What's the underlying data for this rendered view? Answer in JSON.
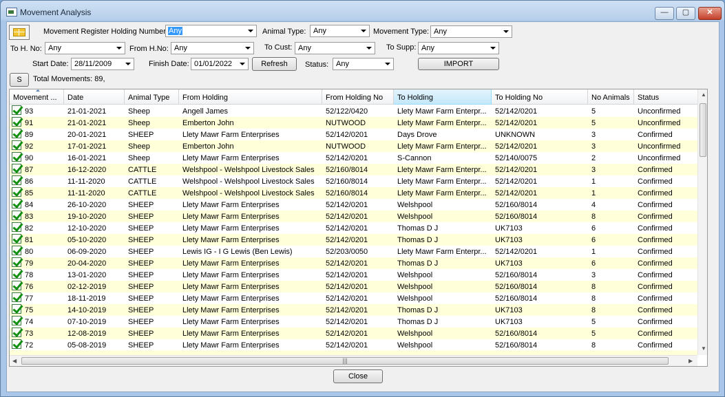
{
  "window": {
    "title": "Movement Analysis",
    "minimize": "—",
    "maximize": "▢",
    "close": "✕"
  },
  "filters": {
    "holding_number_label": "Movement Register Holding Number:",
    "holding_number_value": "Any",
    "animal_type_label": "Animal Type:",
    "animal_type_value": "Any",
    "movement_type_label": "Movement Type:",
    "movement_type_value": "Any",
    "to_h_no_label": "To H. No:",
    "to_h_no_value": "Any",
    "from_h_no_label": "From H.No:",
    "from_h_no_value": "Any",
    "to_cust_label": "To Cust:",
    "to_cust_value": "Any",
    "to_supp_label": "To Supp:",
    "to_supp_value": "Any",
    "start_date_label": "Start Date:",
    "start_date_value": "28/11/2009",
    "finish_date_label": "Finish Date:",
    "finish_date_value": "01/01/2022",
    "refresh_label": "Refresh",
    "status_label": "Status:",
    "status_value": "Any",
    "import_label": "IMPORT",
    "s_button_label": "S",
    "total_movements": "Total Movements: 89,"
  },
  "table": {
    "columns": [
      "Movement ...",
      "Date",
      "Animal Type",
      "From Holding",
      "From Holding No",
      "To Holding",
      "To Holding No",
      "No Animals",
      "Status"
    ],
    "rows": [
      [
        "93",
        "21-01-2021",
        "Sheep",
        "Angell James",
        "52/122/0420",
        "Llety Mawr Farm Enterpr...",
        "52/142/0201",
        "5",
        "Unconfirmed"
      ],
      [
        "91",
        "21-01-2021",
        "Sheep",
        "Emberton John",
        "NUTWOOD",
        "Llety Mawr Farm Enterpr...",
        "52/142/0201",
        "5",
        "Unconfirmed"
      ],
      [
        "89",
        "20-01-2021",
        "SHEEP",
        "Llety Mawr Farm Enterprises",
        "52/142/0201",
        "Days Drove",
        "UNKNOWN",
        "3",
        "Confirmed"
      ],
      [
        "92",
        "17-01-2021",
        "Sheep",
        "Emberton John",
        "NUTWOOD",
        "Llety Mawr Farm Enterpr...",
        "52/142/0201",
        "3",
        "Unconfirmed"
      ],
      [
        "90",
        "16-01-2021",
        "Sheep",
        "Llety Mawr Farm Enterprises",
        "52/142/0201",
        "S-Cannon",
        "52/140/0075",
        "2",
        "Unconfirmed"
      ],
      [
        "87",
        "16-12-2020",
        "CATTLE",
        "Welshpool - Welshpool Livestock Sales",
        "52/160/8014",
        "Llety Mawr Farm Enterpr...",
        "52/142/0201",
        "3",
        "Confirmed"
      ],
      [
        "86",
        "11-11-2020",
        "CATTLE",
        "Welshpool - Welshpool Livestock Sales",
        "52/160/8014",
        "Llety Mawr Farm Enterpr...",
        "52/142/0201",
        "1",
        "Confirmed"
      ],
      [
        "85",
        "11-11-2020",
        "CATTLE",
        "Welshpool - Welshpool Livestock Sales",
        "52/160/8014",
        "Llety Mawr Farm Enterpr...",
        "52/142/0201",
        "1",
        "Confirmed"
      ],
      [
        "84",
        "26-10-2020",
        "SHEEP",
        "Llety Mawr Farm Enterprises",
        "52/142/0201",
        "Welshpool",
        "52/160/8014",
        "4",
        "Confirmed"
      ],
      [
        "83",
        "19-10-2020",
        "SHEEP",
        "Llety Mawr Farm Enterprises",
        "52/142/0201",
        "Welshpool",
        "52/160/8014",
        "8",
        "Confirmed"
      ],
      [
        "82",
        "12-10-2020",
        "SHEEP",
        "Llety Mawr Farm Enterprises",
        "52/142/0201",
        "Thomas D J",
        "UK7103",
        "6",
        "Confirmed"
      ],
      [
        "81",
        "05-10-2020",
        "SHEEP",
        "Llety Mawr Farm Enterprises",
        "52/142/0201",
        "Thomas D J",
        "UK7103",
        "6",
        "Confirmed"
      ],
      [
        "80",
        "06-09-2020",
        "SHEEP",
        "Lewis IG - I G Lewis (Ben Lewis)",
        "52/203/0050",
        "Llety Mawr Farm Enterpr...",
        "52/142/0201",
        "1",
        "Confirmed"
      ],
      [
        "79",
        "20-04-2020",
        "SHEEP",
        "Llety Mawr Farm Enterprises",
        "52/142/0201",
        "Thomas D J",
        "UK7103",
        "6",
        "Confirmed"
      ],
      [
        "78",
        "13-01-2020",
        "SHEEP",
        "Llety Mawr Farm Enterprises",
        "52/142/0201",
        "Welshpool",
        "52/160/8014",
        "3",
        "Confirmed"
      ],
      [
        "76",
        "02-12-2019",
        "SHEEP",
        "Llety Mawr Farm Enterprises",
        "52/142/0201",
        "Welshpool",
        "52/160/8014",
        "8",
        "Confirmed"
      ],
      [
        "77",
        "18-11-2019",
        "SHEEP",
        "Llety Mawr Farm Enterprises",
        "52/142/0201",
        "Welshpool",
        "52/160/8014",
        "8",
        "Confirmed"
      ],
      [
        "75",
        "14-10-2019",
        "SHEEP",
        "Llety Mawr Farm Enterprises",
        "52/142/0201",
        "Thomas D J",
        "UK7103",
        "8",
        "Confirmed"
      ],
      [
        "74",
        "07-10-2019",
        "SHEEP",
        "Llety Mawr Farm Enterprises",
        "52/142/0201",
        "Thomas D J",
        "UK7103",
        "5",
        "Confirmed"
      ],
      [
        "73",
        "12-08-2019",
        "SHEEP",
        "Llety Mawr Farm Enterprises",
        "52/142/0201",
        "Welshpool",
        "52/160/8014",
        "5",
        "Confirmed"
      ],
      [
        "72",
        "05-08-2019",
        "SHEEP",
        "Llety Mawr Farm Enterprises",
        "52/142/0201",
        "Welshpool",
        "52/160/8014",
        "8",
        "Confirmed"
      ]
    ]
  },
  "footer": {
    "close_label": "Close"
  },
  "colors": {
    "row_alt": "#ffffd9",
    "header_selected": "#c4e8fa",
    "check_green": "#119011"
  }
}
